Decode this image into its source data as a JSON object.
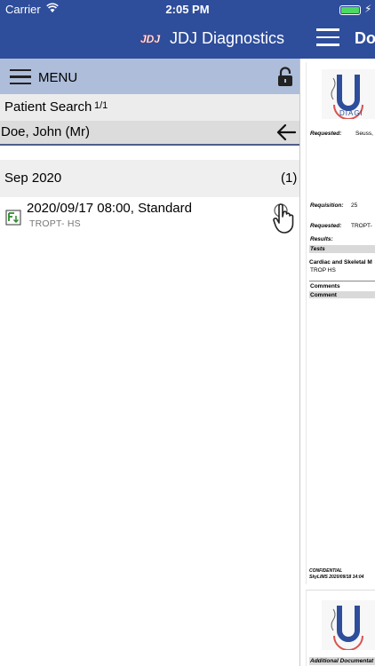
{
  "status_bar": {
    "carrier": "Carrier",
    "time": "2:05 PM",
    "battery_level": 1.0,
    "battery_color": "#4cd964"
  },
  "nav_bar": {
    "logo_text": "JDJ",
    "brand": "JDJ Diagnostics",
    "doc_title": "Do",
    "background": "#2e4d9b"
  },
  "left_pane": {
    "menu_label": "MENU",
    "search_label": "Patient Search",
    "search_count": "1/1",
    "patient_name": "Doe, John (Mr)",
    "groups": [
      {
        "month": "Sep 2020",
        "count": "(1)",
        "items": [
          {
            "title": "2020/09/17 08:00, Standard",
            "subtitle": "TROPT- HS"
          }
        ]
      }
    ]
  },
  "document": {
    "requested_label": "Requested:",
    "requested_value": "Seuss,",
    "requisition_label": "Requisition:",
    "requisition_value": "25",
    "requested2_label": "Requested:",
    "requested2_value": "TROPT-",
    "results_label": "Results:",
    "tests_label": "Tests",
    "test_group": "Cardiac and Skeletal M",
    "test_item": "TROP HS",
    "comments_label": "Comments",
    "comment_label": "Comment",
    "footer_confidential": "CONFIDENTIAL",
    "footer_stamp": "SkyLIMS 2020/09/18 14:04",
    "logo_text": "DIAGI",
    "page2_header": "Additional Documentat"
  },
  "icons": {
    "wifi": "wifi-icon",
    "battery": "battery-icon",
    "charging": "bolt-icon",
    "menu": "hamburger-icon",
    "lock": "lock-icon",
    "back": "back-arrow-icon",
    "document": "document-download-icon",
    "tap": "hand-pointer-icon"
  }
}
